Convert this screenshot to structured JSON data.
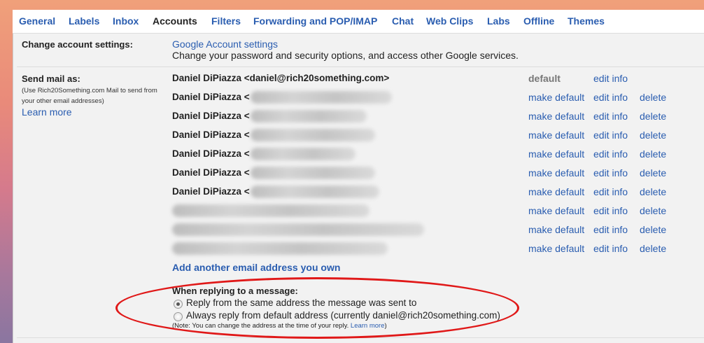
{
  "tabs": [
    {
      "label": "General"
    },
    {
      "label": "Labels"
    },
    {
      "label": "Inbox"
    },
    {
      "label": "Accounts"
    },
    {
      "label": "Filters"
    },
    {
      "label": "Forwarding and POP/IMAP"
    },
    {
      "label": "Chat"
    },
    {
      "label": "Web Clips"
    },
    {
      "label": "Labs"
    },
    {
      "label": "Offline"
    },
    {
      "label": "Themes"
    }
  ],
  "active_tab": "Accounts",
  "change_account": {
    "label": "Change account settings:",
    "link": "Google Account settings",
    "description": "Change your password and security options, and access other Google services."
  },
  "send_mail": {
    "label": "Send mail as:",
    "note": "(Use Rich20Something.com Mail to send from your other email addresses)",
    "learn_more": "Learn more",
    "rows": [
      {
        "name": "Daniel DiPiazza <daniel@rich20something.com>",
        "is_default": true
      },
      {
        "name": "Daniel DiPiazza <",
        "is_default": false
      },
      {
        "name": "Daniel DiPiazza <",
        "is_default": false
      },
      {
        "name": "Daniel DiPiazza <",
        "is_default": false
      },
      {
        "name": "Daniel DiPiazza <",
        "is_default": false
      },
      {
        "name": "Daniel DiPiazza <",
        "is_default": false
      },
      {
        "name": "Daniel DiPiazza <",
        "is_default": false
      },
      {
        "name": "",
        "is_default": false
      },
      {
        "name": "",
        "is_default": false
      },
      {
        "name": "",
        "is_default": false
      }
    ],
    "default_label": "default",
    "make_default": "make default",
    "edit_info": "edit info",
    "delete": "delete",
    "add_address": "Add another email address you own"
  },
  "reply": {
    "heading": "When replying to a message:",
    "option_same": "Reply from the same address the message was sent to",
    "option_default": "Always reply from default address (currently daniel@rich20something.com)",
    "note": "(Note: You can change the address at the time of your reply.",
    "note_link": "Learn more",
    "note_end": ")",
    "selected": "same"
  },
  "colors": {
    "link": "#2a5db0",
    "annotation": "#e01818",
    "panel": "#f2f2f2"
  }
}
